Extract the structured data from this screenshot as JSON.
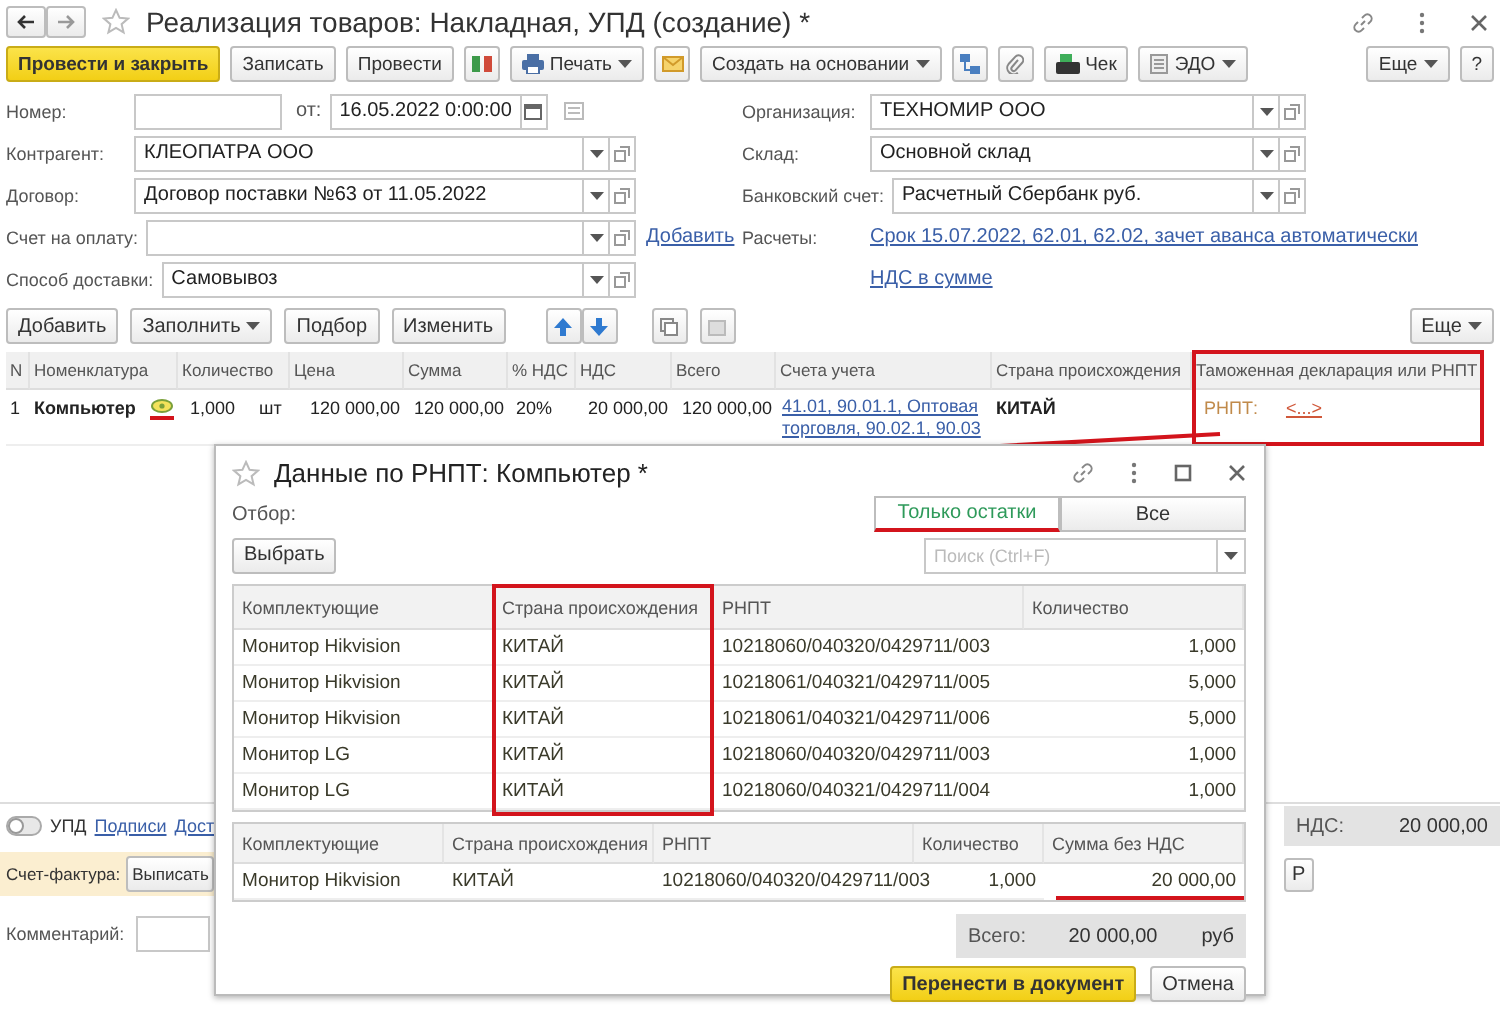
{
  "window": {
    "title": "Реализация товаров: Накладная, УПД (создание) *"
  },
  "toolbar": [
    {
      "label": "Провести и закрыть",
      "kind": "primary"
    },
    {
      "label": "Записать",
      "kind": "plain"
    },
    {
      "label": "Провести",
      "kind": "plain"
    },
    {
      "label": "Печать",
      "kind": "menu"
    },
    {
      "label": "Создать на основании",
      "kind": "menu"
    },
    {
      "label": "Чек",
      "kind": "plain"
    },
    {
      "label": "ЭДО",
      "kind": "menu"
    },
    {
      "label": "Еще",
      "kind": "menu"
    },
    {
      "label": "?",
      "kind": "plain"
    }
  ],
  "fields_left": [
    {
      "label": "Номер:",
      "kind": "number"
    },
    {
      "label": "Контрагент:",
      "kind": "select",
      "value": "КЛЕОПАТРА ООО"
    },
    {
      "label": "Договор:",
      "kind": "select",
      "value": "Договор поставки №63 от 11.05.2022"
    },
    {
      "label": "Счет на оплату:",
      "kind": "select",
      "link": "Добавить"
    },
    {
      "label": "Способ доставки:",
      "kind": "select",
      "value": "Самовывоз"
    }
  ],
  "date": {
    "label": "от:",
    "value": "16.05.2022 0:00:00"
  },
  "fields_right": [
    {
      "label": "Организация:",
      "kind": "select",
      "value": "ТЕХНОМИР ООО"
    },
    {
      "label": "Склад:",
      "kind": "select",
      "value": "Основной склад"
    },
    {
      "label": "Банковский счет:",
      "kind": "select",
      "value": "Расчетный Сбербанк руб."
    },
    {
      "label": "Расчеты:",
      "kind": "link",
      "value": "Срок 15.07.2022, 62.01, 62.02, зачет аванса автоматически"
    },
    {
      "kind": "link",
      "value": "НДС в сумме"
    }
  ],
  "table_toolbar": [
    {
      "label": "Добавить",
      "menu": false
    },
    {
      "label": "Заполнить",
      "menu": true
    },
    {
      "label": "Подбор",
      "menu": false
    },
    {
      "label": "Изменить",
      "menu": false
    },
    {
      "label": "Еще",
      "menu": true
    }
  ],
  "table": {
    "columns": [
      "N",
      "Номенклатура",
      "Количество",
      "Цена",
      "Сумма",
      "% НДС",
      "НДС",
      "Всего",
      "Счета учета",
      "Страна происхождения",
      "Таможенная декларация или РНПТ"
    ],
    "rows": [
      {
        "n": "1",
        "item": "Компьютер",
        "quantity": "1,000",
        "unit": "шт",
        "price": "120 000,00",
        "sum": "120 000,00",
        "vat_rate": "20%",
        "vat": "20 000,00",
        "total": "120 000,00",
        "accounts": "41.01, 90.01.1, Оптовая торговля, 90.02.1, 90.03",
        "country": "КИТАЙ",
        "customs_label": "РНПТ:",
        "customs_value": "<...>"
      }
    ]
  },
  "footer": {
    "upd": {
      "label": "УПД",
      "on": false
    },
    "links": [
      "Подписи",
      "Дост"
    ],
    "vat_label": "НДС:",
    "vat_total": "20 000,00",
    "invoice_label": "Счет-фактура:",
    "invoice_button": "Выписать",
    "cut_button": "Р",
    "comment_label": "Комментарий:"
  },
  "dialog": {
    "title": "Данные по РНПТ: Компьютер *",
    "filter_label": "Отбор:",
    "filter_options": [
      {
        "label": "Только остатки",
        "selected": true
      },
      {
        "label": "Все",
        "selected": false
      }
    ],
    "select_button": "Выбрать",
    "search": {
      "placeholder": "Поиск (Ctrl+F)"
    },
    "available": {
      "columns": [
        "Комплектующие",
        "Страна происхождения",
        "РНПТ",
        "Количество"
      ],
      "rows": [
        {
          "component": "Монитор Hikvision",
          "country": "КИТАЙ",
          "rnpt": "10218060/040320/0429711/003",
          "quantity": "1,000"
        },
        {
          "component": "Монитор Hikvision",
          "country": "КИТАЙ",
          "rnpt": "10218061/040321/0429711/005",
          "quantity": "5,000"
        },
        {
          "component": "Монитор Hikvision",
          "country": "КИТАЙ",
          "rnpt": "10218061/040321/0429711/006",
          "quantity": "5,000"
        },
        {
          "component": "Монитор LG",
          "country": "КИТАЙ",
          "rnpt": "10218060/040320/0429711/003",
          "quantity": "1,000"
        },
        {
          "component": "Монитор LG",
          "country": "КИТАЙ",
          "rnpt": "10218060/040321/0429711/004",
          "quantity": "1,000"
        }
      ]
    },
    "chosen": {
      "columns": [
        "Комплектующие",
        "Страна происхождения",
        "РНПТ",
        "Количество",
        "Сумма без НДС"
      ],
      "rows": [
        {
          "component": "Монитор Hikvision",
          "country": "КИТАЙ",
          "rnpt": "10218060/040320/0429711/003",
          "quantity": "1,000",
          "sum": "20 000,00"
        }
      ]
    },
    "total_label": "Всего:",
    "total": "20 000,00",
    "currency": "руб",
    "buttons": [
      {
        "label": "Перенести в документ",
        "kind": "primary"
      },
      {
        "label": "Отмена",
        "kind": "plain"
      }
    ]
  }
}
